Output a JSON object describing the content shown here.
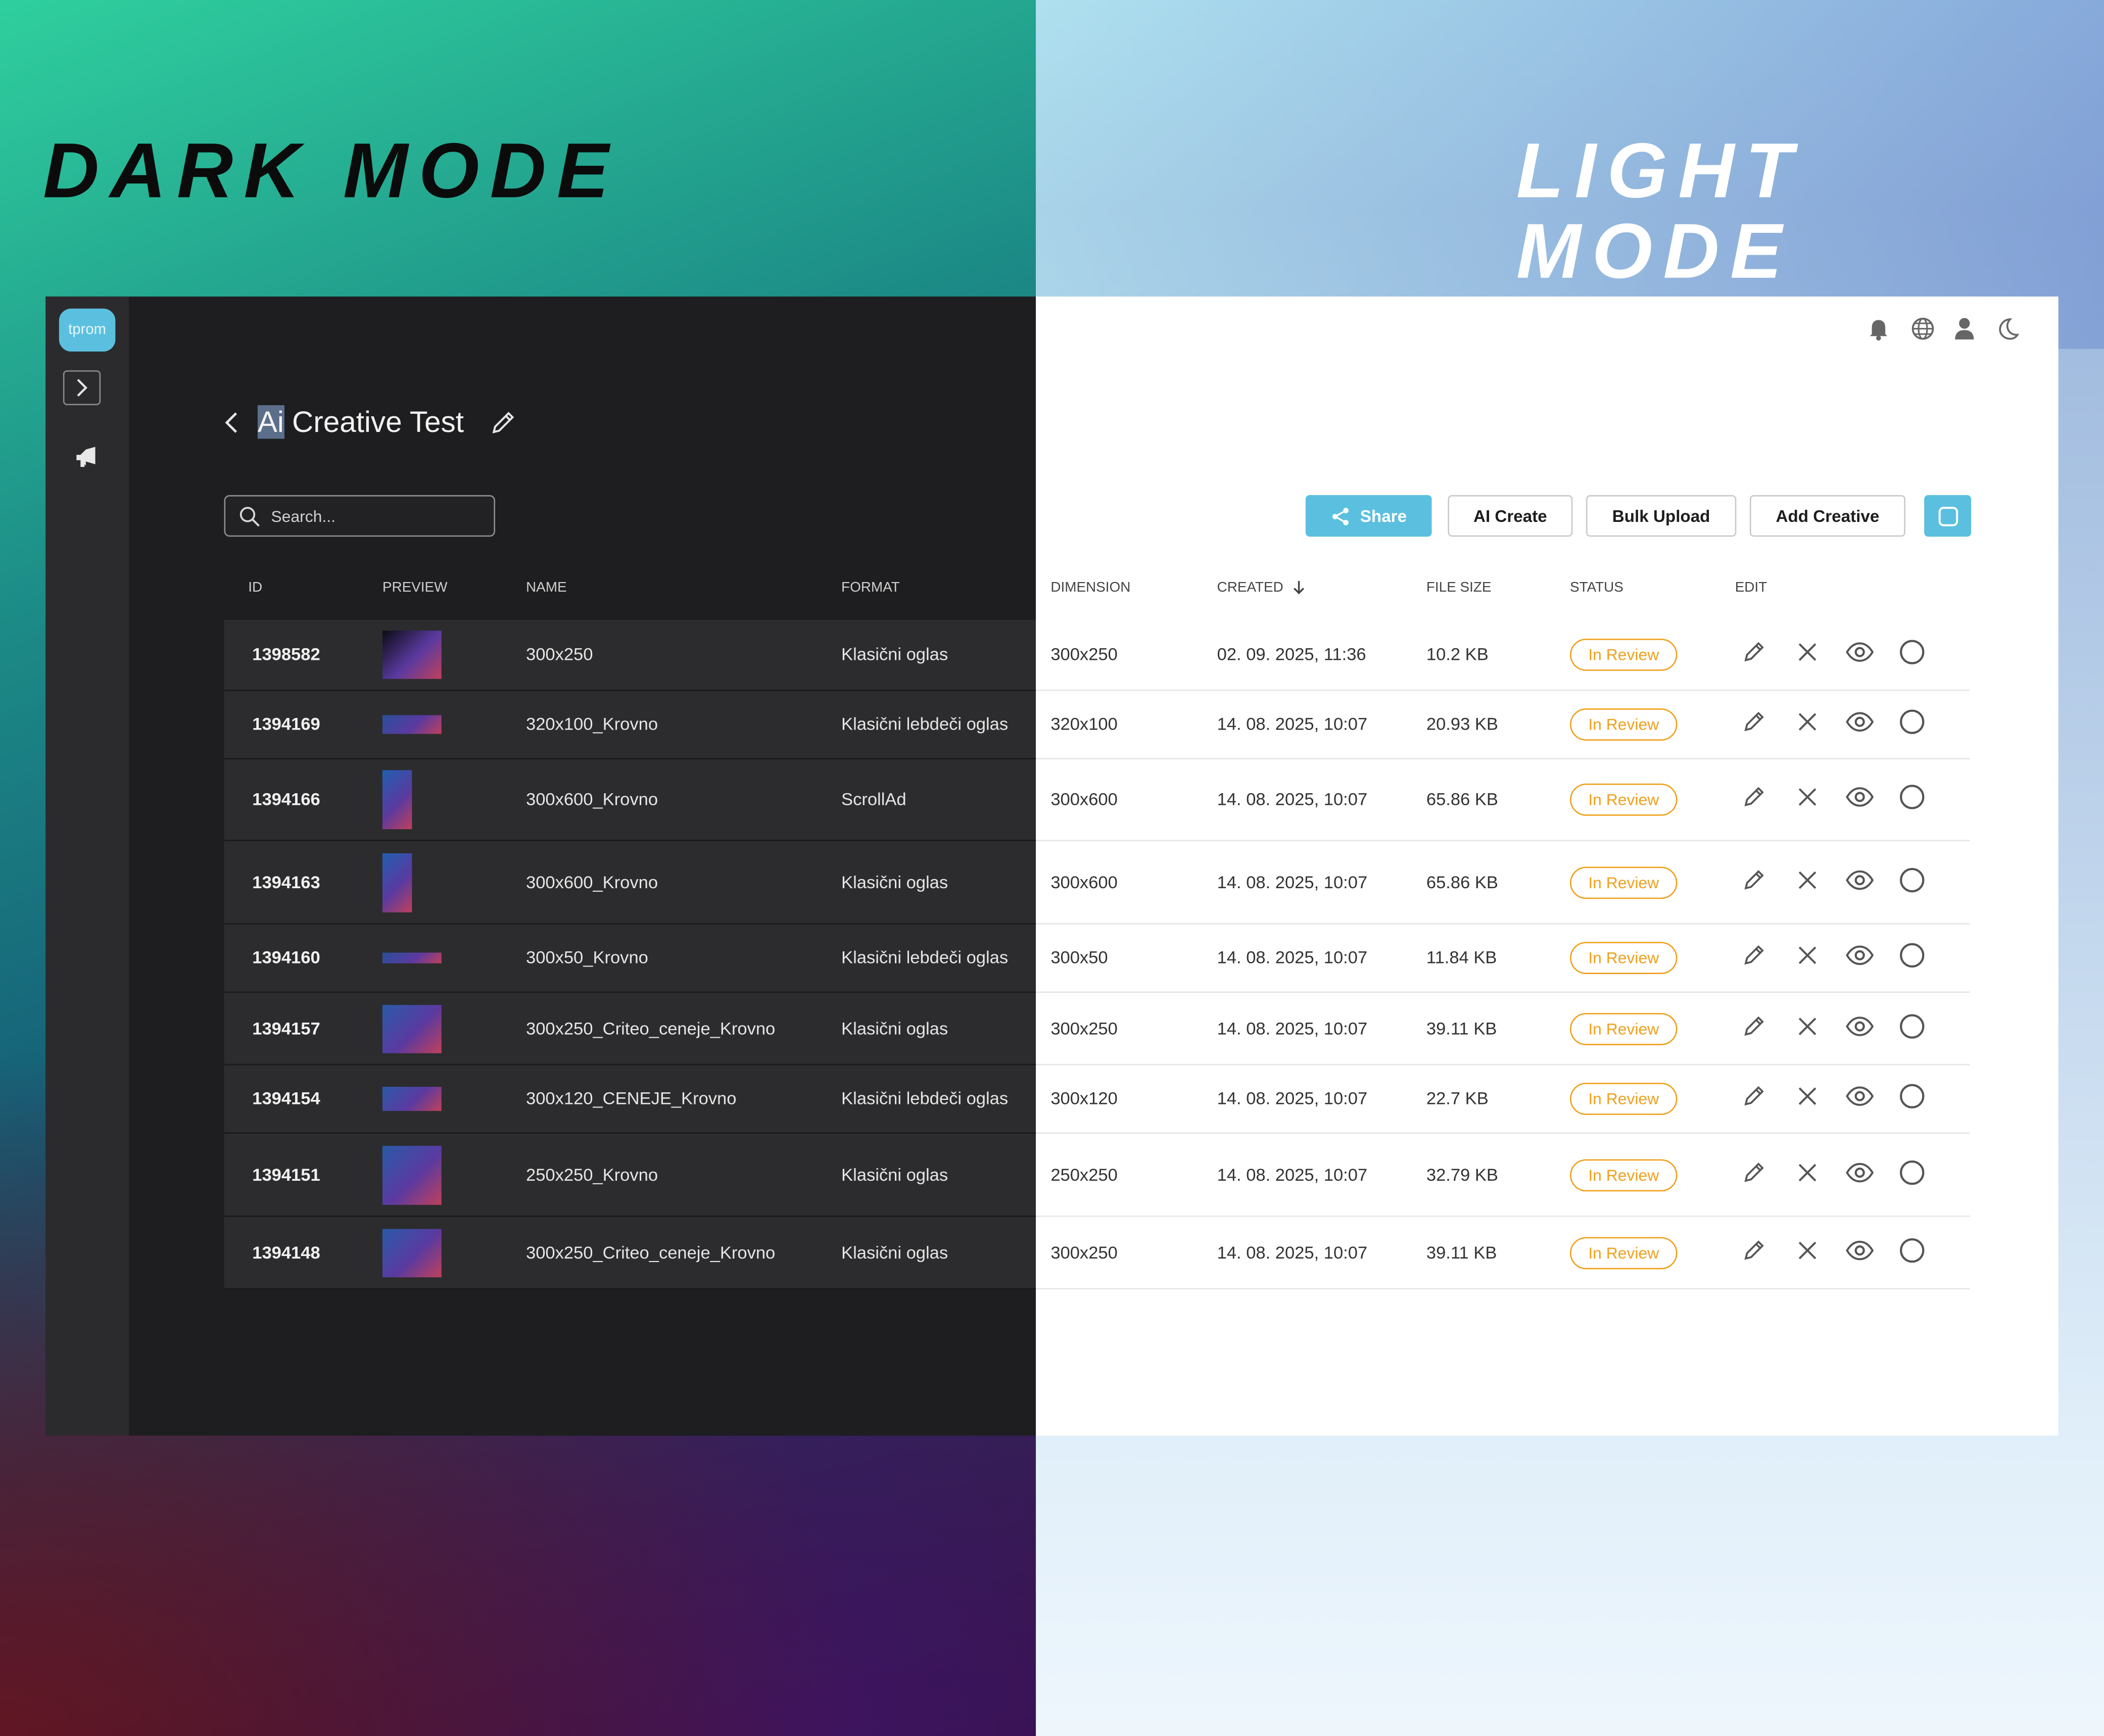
{
  "banner": {
    "dark_title": "DARK MODE",
    "light_title": "LIGHT MODE"
  },
  "app": {
    "logo_text": "tprom"
  },
  "page": {
    "title_highlight": "Ai",
    "title_rest": " Creative Test",
    "search_placeholder": "Search..."
  },
  "toolbar": {
    "share_label": "Share",
    "ai_create_label": "AI Create",
    "bulk_upload_label": "Bulk Upload",
    "add_creative_label": "Add Creative"
  },
  "header_icons": [
    "bell-icon",
    "globe-icon",
    "user-icon",
    "moon-icon"
  ],
  "table": {
    "columns": [
      "ID",
      "PREVIEW",
      "NAME",
      "FORMAT",
      "DIMENSION",
      "CREATED",
      "FILE SIZE",
      "STATUS",
      "EDIT"
    ],
    "sort_column": "CREATED",
    "sort_direction": "desc",
    "rows": [
      {
        "id": "1398582",
        "name": "300x250",
        "format": "Klasični oglas",
        "dimension": "300x250",
        "created": "02. 09. 2025, 11:36",
        "size": "10.2 KB",
        "status": "In Review"
      },
      {
        "id": "1394169",
        "name": "320x100_Krovno",
        "format": "Klasični lebdeči oglas",
        "dimension": "320x100",
        "created": "14. 08. 2025, 10:07",
        "size": "20.93 KB",
        "status": "In Review"
      },
      {
        "id": "1394166",
        "name": "300x600_Krovno",
        "format": "ScrollAd",
        "dimension": "300x600",
        "created": "14. 08. 2025, 10:07",
        "size": "65.86 KB",
        "status": "In Review"
      },
      {
        "id": "1394163",
        "name": "300x600_Krovno",
        "format": "Klasični oglas",
        "dimension": "300x600",
        "created": "14. 08. 2025, 10:07",
        "size": "65.86 KB",
        "status": "In Review"
      },
      {
        "id": "1394160",
        "name": "300x50_Krovno",
        "format": "Klasični lebdeči oglas",
        "dimension": "300x50",
        "created": "14. 08. 2025, 10:07",
        "size": "11.84 KB",
        "status": "In Review"
      },
      {
        "id": "1394157",
        "name": "300x250_Criteo_ceneje_Krovno",
        "format": "Klasični oglas",
        "dimension": "300x250",
        "created": "14. 08. 2025, 10:07",
        "size": "39.11 KB",
        "status": "In Review"
      },
      {
        "id": "1394154",
        "name": "300x120_CENEJE_Krovno",
        "format": "Klasični lebdeči oglas",
        "dimension": "300x120",
        "created": "14. 08. 2025, 10:07",
        "size": "22.7 KB",
        "status": "In Review"
      },
      {
        "id": "1394151",
        "name": "250x250_Krovno",
        "format": "Klasični oglas",
        "dimension": "250x250",
        "created": "14. 08. 2025, 10:07",
        "size": "32.79 KB",
        "status": "In Review"
      },
      {
        "id": "1394148",
        "name": "300x250_Criteo_ceneje_Krovno",
        "format": "Klasični oglas",
        "dimension": "300x250",
        "created": "14. 08. 2025, 10:07",
        "size": "39.11 KB",
        "status": "In Review"
      }
    ]
  },
  "row_actions": [
    "edit-icon",
    "delete-icon",
    "preview-eye-icon",
    "select-circle-icon"
  ],
  "colors": {
    "accent": "#5bc0e0",
    "status": "#f0a01c",
    "dark_bg": "#1e1e20",
    "dark_row": "#2c2c2e"
  }
}
